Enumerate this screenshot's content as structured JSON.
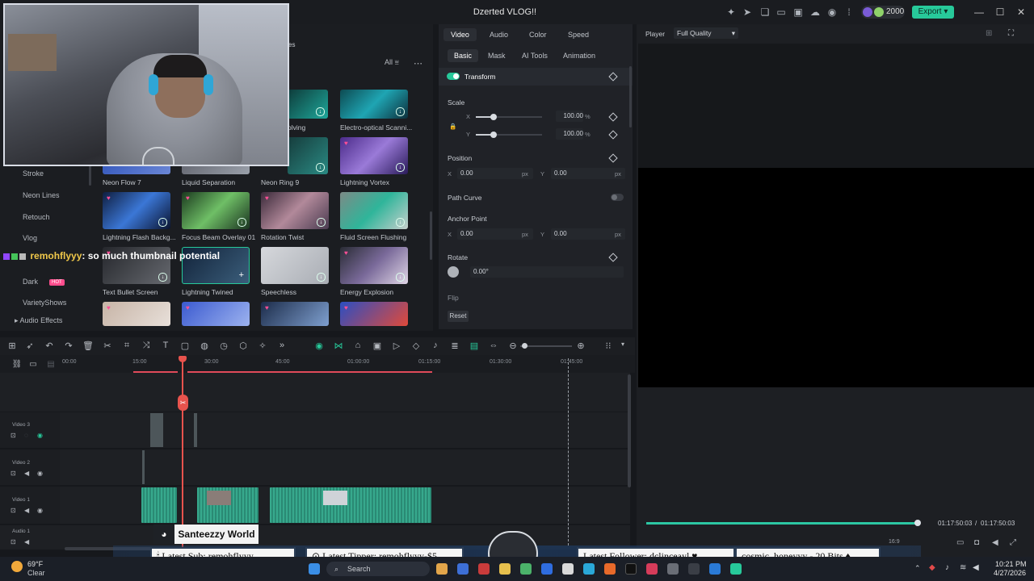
{
  "app": {
    "title": "Dzerted VLOG!!",
    "export_label": "Export",
    "credits": "2000"
  },
  "library": {
    "filter_label": "All",
    "categories": [
      "Stroke",
      "Neon Lines",
      "Retouch",
      "Vlog",
      "Dark",
      "VarietyShows",
      "Audio Effects"
    ],
    "hot_badge": "HOT",
    "thumbnails": [
      {
        "label": "Neon Flow 7"
      },
      {
        "label": "Liquid Separation"
      },
      {
        "label": "Neon Ring 9"
      },
      {
        "label": "Lightning Vortex"
      },
      {
        "label": "Lightning Flash Backg..."
      },
      {
        "label": "Focus Beam Overlay 01"
      },
      {
        "label": "Rotation Twist"
      },
      {
        "label": "Fluid Screen Flushing"
      },
      {
        "label": "Text Bullet Screen"
      },
      {
        "label": "Lightning Twined"
      },
      {
        "label": "Speechless"
      },
      {
        "label": "Energy Explosion"
      },
      {
        "label": "olving"
      },
      {
        "label": "Electro-optical Scanni..."
      }
    ]
  },
  "chat": {
    "user": "remohflyyy",
    "message": ": so much thumbnail potential"
  },
  "properties": {
    "tabs": [
      "Video",
      "Audio",
      "Color",
      "Speed"
    ],
    "subtabs": [
      "Basic",
      "Mask",
      "AI Tools",
      "Animation"
    ],
    "transform_label": "Transform",
    "scale_label": "Scale",
    "scale_x": "100.00",
    "scale_y": "100.00",
    "percent": "%",
    "axis_x": "X",
    "axis_y": "Y",
    "position_label": "Position",
    "pos_x": "0.00",
    "pos_y": "0.00",
    "px": "px",
    "path_curve_label": "Path Curve",
    "anchor_label": "Anchor Point",
    "anchor_x": "0.00",
    "anchor_y": "0.00",
    "rotate_label": "Rotate",
    "rotate_value": "0.00°",
    "flip_label": "Flip",
    "reset_label": "Reset"
  },
  "player": {
    "label": "Player",
    "quality": "Full Quality",
    "current_time": "01:17:50:03",
    "separator": "/",
    "total_time": "01:17:50:03",
    "ratio": "16:9",
    "progress": 0.995
  },
  "timeline": {
    "ruler": [
      "00:00",
      "15:00",
      "30:00",
      "45:00",
      "01:00:00",
      "01:15:00",
      "01:30:00",
      "01:45:00"
    ],
    "tracks": [
      {
        "name": "Video 3"
      },
      {
        "name": "Video 2"
      },
      {
        "name": "Video 1"
      },
      {
        "name": "Audio 1"
      }
    ]
  },
  "overlay": {
    "discord_name": "Santeezzy World",
    "latest_sub": "Latest Sub: remohflyyy",
    "latest_tipper": "Latest Tipper: remohflyyy-$5",
    "latest_follower": "Latest Follower: dclinceayl",
    "bits": "cosmic_honeyyy - 20 Bits"
  },
  "taskbar": {
    "temperature": "69°F",
    "condition": "Clear",
    "search_placeholder": "Search",
    "time": "10:21 PM",
    "date": "4/27/2026"
  },
  "colors": {
    "accent": "#27c99a",
    "playhead": "#e8534d",
    "background": "#16181c"
  }
}
